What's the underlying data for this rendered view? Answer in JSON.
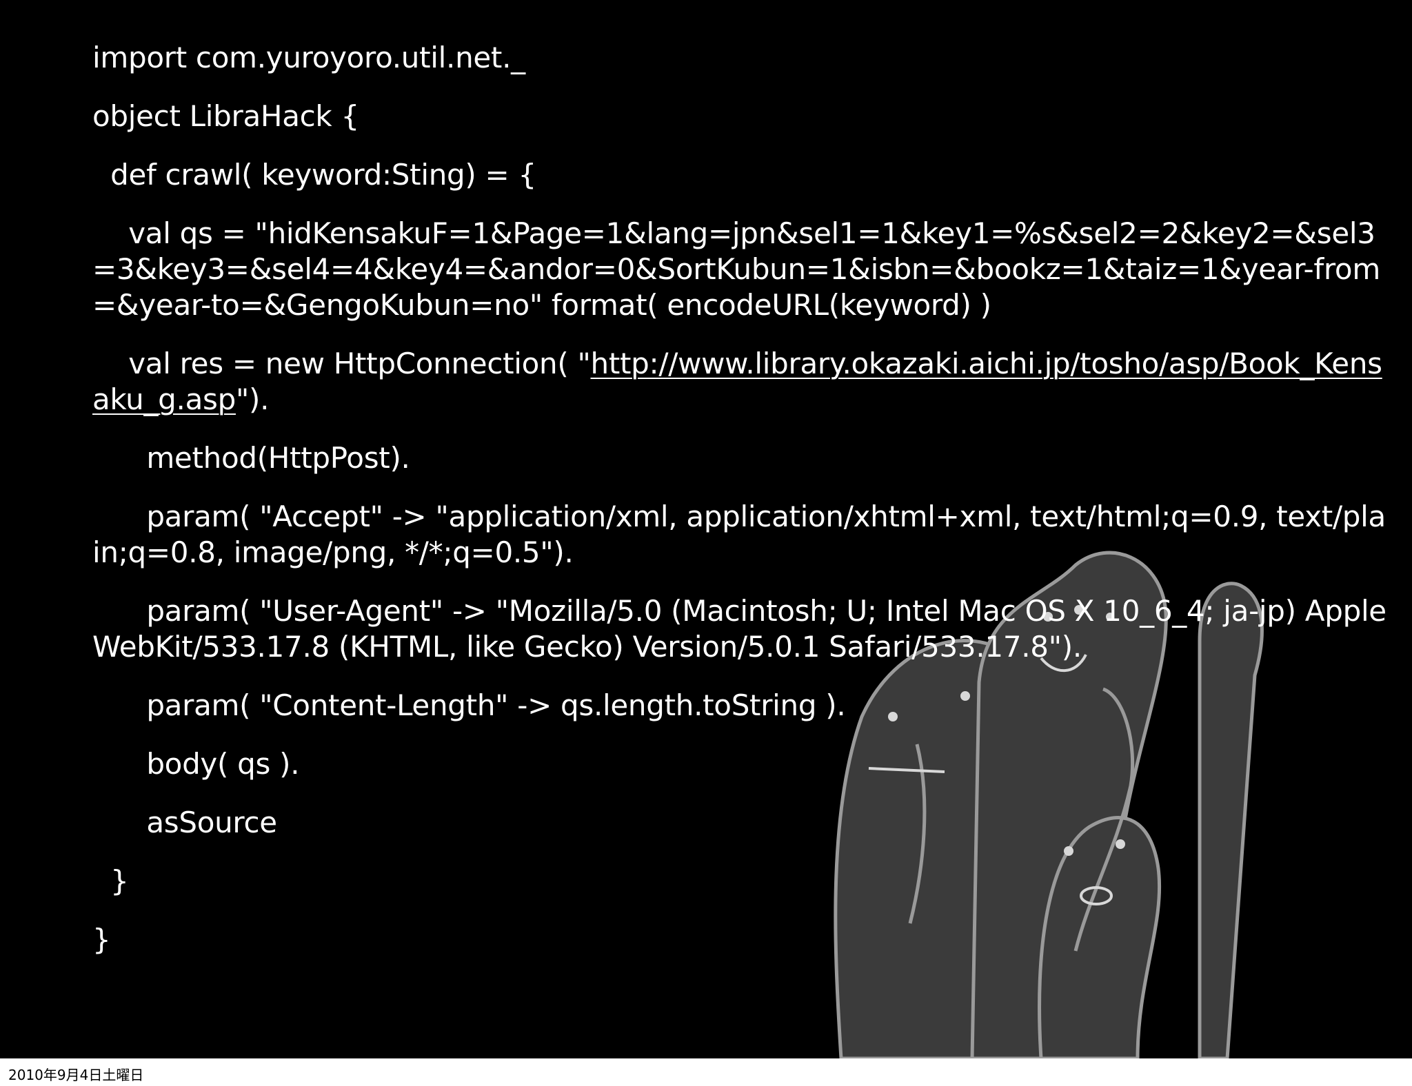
{
  "code_lines": [
    "import com.yuroyoro.util.net._",
    "object LibraHack {",
    "  def crawl( keyword:Sting) = {",
    "    val qs = \"hidKensakuF=1&Page=1&lang=jpn&sel1=1&key1=%s&sel2=2&key2=&sel3=3&key3=&sel4=4&key4=&andor=0&SortKubun=1&isbn=&bookz=1&taiz=1&year-from=&year-to=&GengoKubun=no\" format( encodeURL(keyword) )",
    "    val res = new HttpConnection( \"",
    "http://www.library.okazaki.aichi.jp/tosho/asp/Book_Kensaku_g.asp",
    "\").",
    "      method(HttpPost).",
    "      param( \"Accept\" -> \"application/xml, application/xhtml+xml, text/html;q=0.9, text/plain;q=0.8, image/png, */*;q=0.5\").",
    "      param( \"User-Agent\" -> \"Mozilla/5.0 (Macintosh; U; Intel Mac OS X 10_6_4; ja-jp) AppleWebKit/533.17.8 (KHTML, like Gecko) Version/5.0.1 Safari/533.17.8\").",
    "      param( \"Content-Length\" -> qs.length.toString ).",
    "      body( qs ).",
    "      asSource",
    "  }",
    "}"
  ],
  "footer_date": "2010年9月4日土曜日",
  "illustration_icon": "ghost-figures-illustration",
  "colors": {
    "slide_background": "#000000",
    "text": "#ffffff",
    "illustration_fill": "#3a3a3a",
    "illustration_stroke": "#8a8a8a",
    "footer_background": "#ffffff"
  }
}
